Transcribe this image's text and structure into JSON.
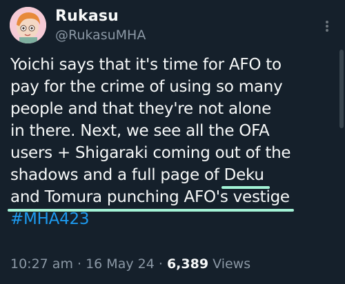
{
  "author": {
    "display_name": "Rukasu",
    "handle": "@RukasuMHA"
  },
  "tweet": {
    "lines": [
      "Yoichi says that it's time for AFO to",
      "pay for the crime of using so many",
      "people and that they're not alone",
      "in there. Next, we see all the OFA",
      "users + Shigaraki coming out of the",
      "shadows and a full page of ",
      "Deku",
      "and Tomura punching AFO's vestige"
    ],
    "hashtag": "#MHA423"
  },
  "meta": {
    "time": "10:27 am",
    "separator": "·",
    "date": "16 May 24",
    "views_count": "6,389",
    "views_label": "Views"
  },
  "colors": {
    "background": "#15202b",
    "text": "#f7f9f9",
    "secondary": "#8b98a5",
    "link": "#1d9bf0",
    "underline_highlight": "#a3f3d6"
  },
  "icons": {
    "more": "more-options-icon",
    "avatar": "avatar"
  }
}
